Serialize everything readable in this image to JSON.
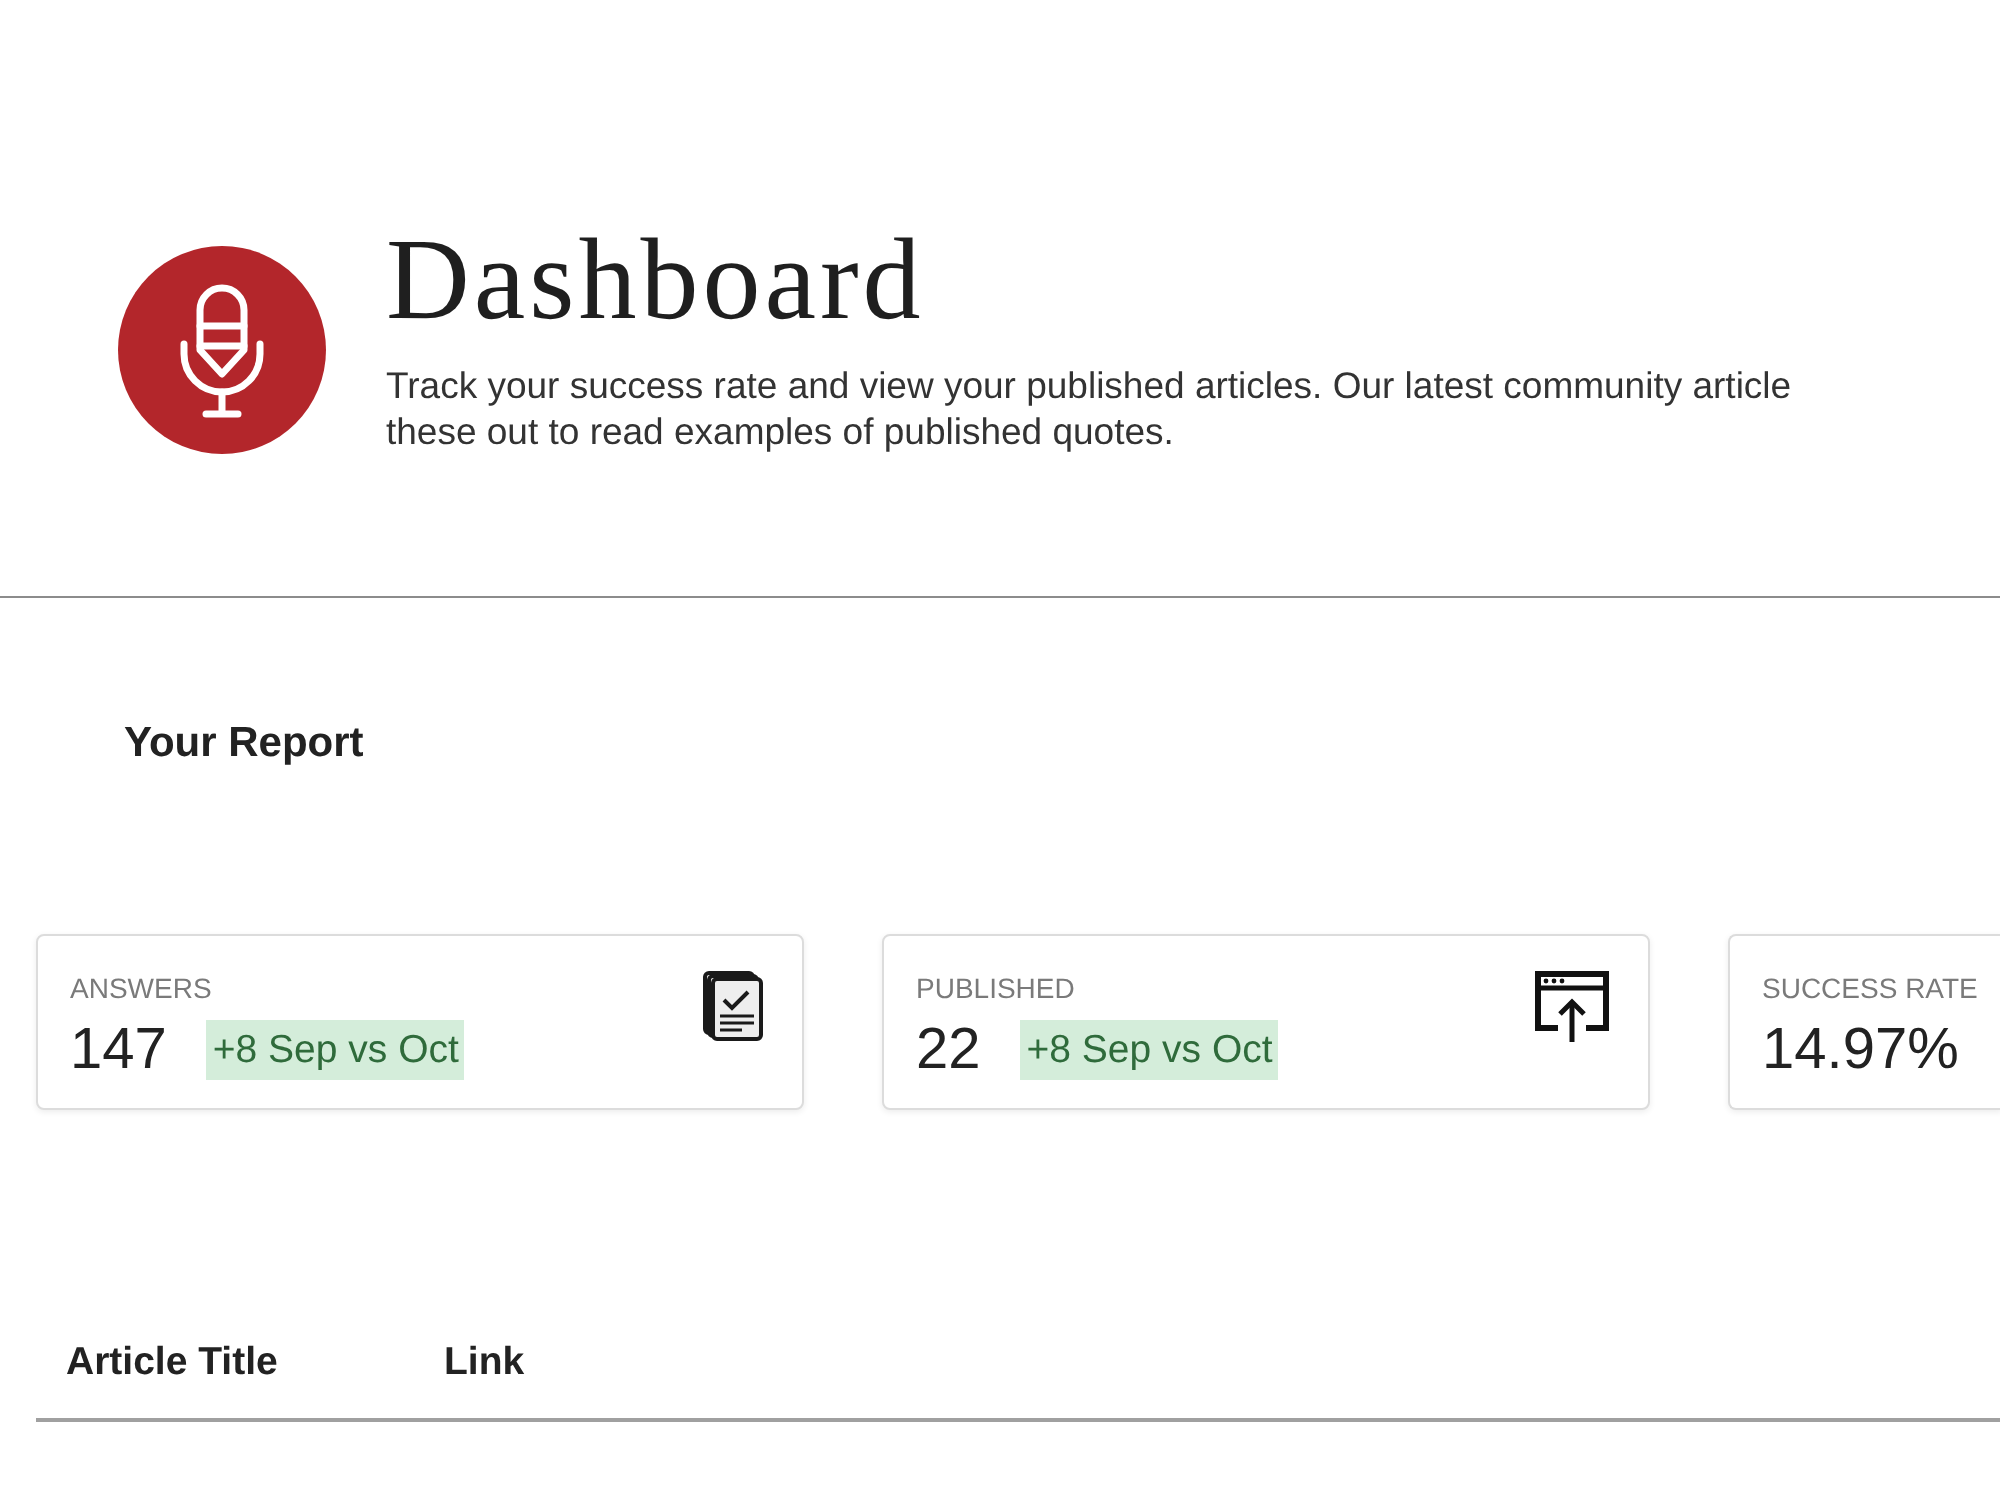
{
  "header": {
    "title": "Dashboard",
    "description_lines": [
      "Track your success rate and view your published articles. Our latest community article",
      "these out to read examples of published quotes."
    ]
  },
  "report": {
    "heading": "Your Report",
    "stats": [
      {
        "kind": "answers",
        "label": "ANSWERS",
        "value": "147",
        "change": "+8 Sep vs Oct"
      },
      {
        "kind": "published",
        "label": "PUBLISHED",
        "value": "22",
        "change": "+8 Sep vs Oct"
      },
      {
        "kind": "success_rate",
        "label": "SUCCESS RATE",
        "value": "14.97%"
      }
    ]
  },
  "table": {
    "columns": [
      "Article Title",
      "Link"
    ]
  }
}
